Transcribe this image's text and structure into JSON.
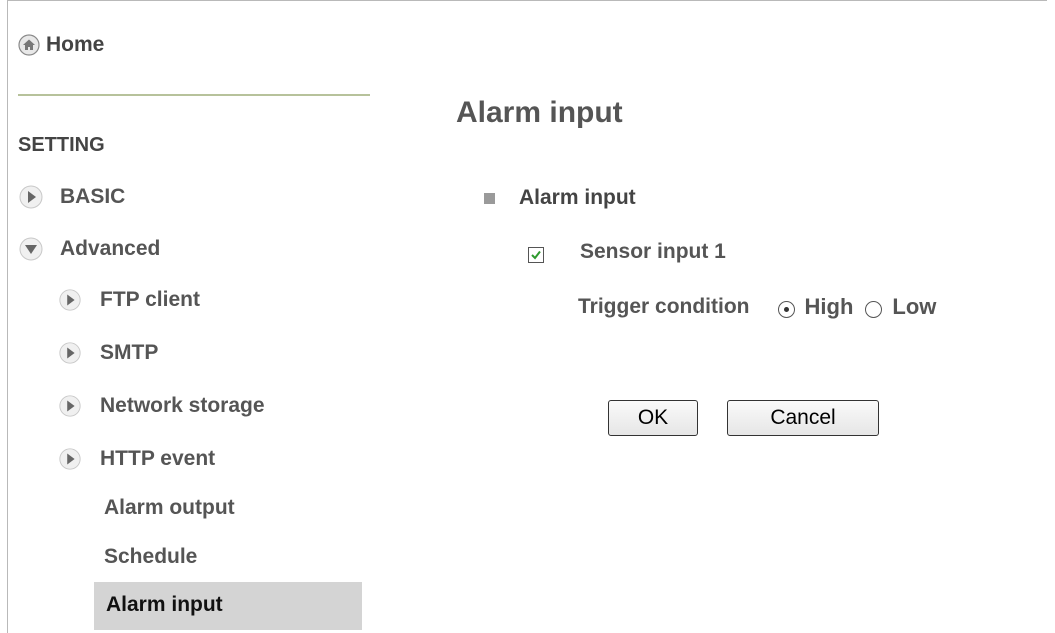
{
  "sidebar": {
    "home_label": "Home",
    "section_title": "SETTING",
    "items": [
      {
        "label": "BASIC",
        "state": "collapsed"
      },
      {
        "label": "Advanced",
        "state": "expanded"
      }
    ],
    "sub_items": [
      {
        "label": "FTP client"
      },
      {
        "label": "SMTP"
      },
      {
        "label": "Network storage"
      },
      {
        "label": "HTTP event"
      }
    ],
    "plain_items": [
      {
        "label": "Alarm output"
      },
      {
        "label": "Schedule"
      }
    ],
    "active_item": "Alarm input"
  },
  "main": {
    "title": "Alarm input",
    "section_label": "Alarm input",
    "sensor_label": "Sensor input 1",
    "sensor_checked": true,
    "trigger_label": "Trigger condition",
    "trigger_options": [
      {
        "label": "High",
        "selected": true
      },
      {
        "label": "Low",
        "selected": false
      }
    ],
    "ok_label": "OK",
    "cancel_label": "Cancel"
  },
  "colors": {
    "active_bg": "#d4d4d4",
    "rule": "#b7c29b",
    "check": "#2e9a2e"
  },
  "icons": {
    "home": "home-icon",
    "collapsed": "arrow-right-icon",
    "expanded": "arrow-down-icon",
    "section": "square-bullet-icon"
  }
}
